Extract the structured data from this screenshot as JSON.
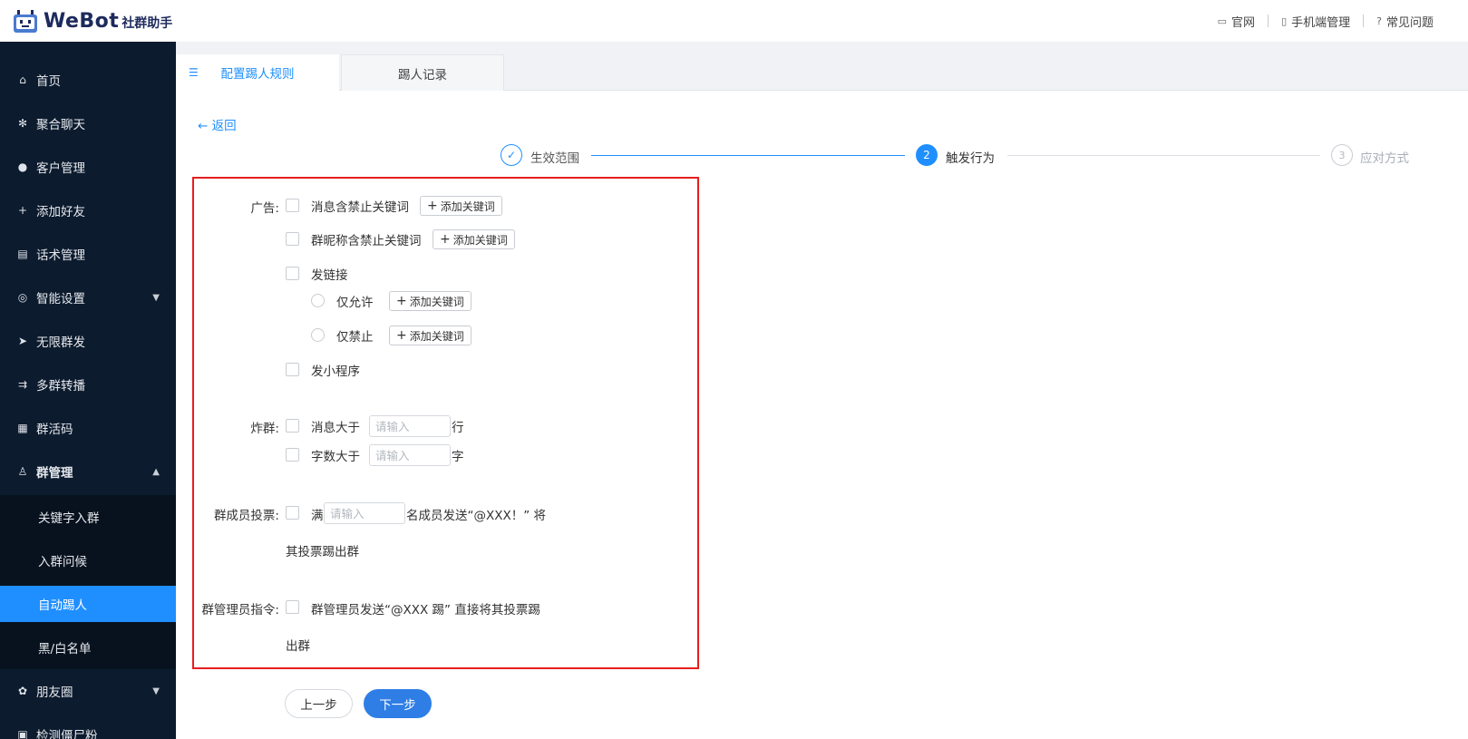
{
  "header": {
    "logo_text": "WeBot",
    "logo_sub": "社群助手",
    "links": [
      {
        "label": "官网",
        "icon": "monitor-icon"
      },
      {
        "label": "手机端管理",
        "icon": "phone-icon"
      },
      {
        "label": "常见问题",
        "icon": "help-icon"
      }
    ]
  },
  "sidebar": {
    "items": [
      {
        "label": "首页",
        "icon": "home-icon"
      },
      {
        "label": "聚合聊天",
        "icon": "gear-icon"
      },
      {
        "label": "客户管理",
        "icon": "user-icon"
      },
      {
        "label": "添加好友",
        "icon": "user-add-icon"
      },
      {
        "label": "话术管理",
        "icon": "document-icon"
      },
      {
        "label": "智能设置",
        "icon": "robot-icon"
      },
      {
        "label": "无限群发",
        "icon": "send-icon"
      },
      {
        "label": "多群转播",
        "icon": "broadcast-icon"
      },
      {
        "label": "群活码",
        "icon": "qrcode-icon"
      },
      {
        "label": "群管理",
        "icon": "group-icon"
      },
      {
        "label": "朋友圈",
        "icon": "circle-icon"
      },
      {
        "label": "检测僵尸粉",
        "icon": "chart-icon"
      }
    ],
    "submenu": [
      {
        "label": "关键字入群"
      },
      {
        "label": "入群问候"
      },
      {
        "label": "自动踢人"
      },
      {
        "label": "黑/白名单"
      }
    ]
  },
  "tabs": [
    {
      "label": "配置踢人规则"
    },
    {
      "label": "踢人记录"
    }
  ],
  "back_label": "← 返回",
  "steps": [
    {
      "label": "生效范围",
      "status": "done"
    },
    {
      "number": "2",
      "label": "触发行为",
      "status": "active"
    },
    {
      "number": "3",
      "label": "应对方式",
      "status": "pending"
    }
  ],
  "form": {
    "ad_label": "广告:",
    "ad_keyword_msg": "消息含禁止关键词",
    "ad_keyword_nick": "群昵称含禁止关键词",
    "add_keyword": "添加关键词",
    "link_label": "发链接",
    "only_allow": "仅允许",
    "only_forbid": "仅禁止",
    "mini_program": "发小程序",
    "flood_label": "炸群:",
    "msg_lines_prefix": "消息大于",
    "msg_lines_suffix": "行",
    "chars_prefix": "字数大于",
    "chars_suffix": "字",
    "input_placeholder": "请输入",
    "vote_label": "群成员投票:",
    "vote_prefix": "满",
    "vote_suffix": "名成员发送“@XXX！” 将",
    "vote_line2": "其投票踢出群",
    "admin_label": "群管理员指令:",
    "admin_text": "群管理员发送“@XXX 踢” 直接将其投票踢",
    "admin_line2": "出群"
  },
  "buttons": {
    "prev": "上一步",
    "next": "下一步"
  },
  "colors": {
    "accent": "#1f8fff",
    "sidebar_bg": "#0c1b2e",
    "highlight_border": "#e61e1e"
  }
}
